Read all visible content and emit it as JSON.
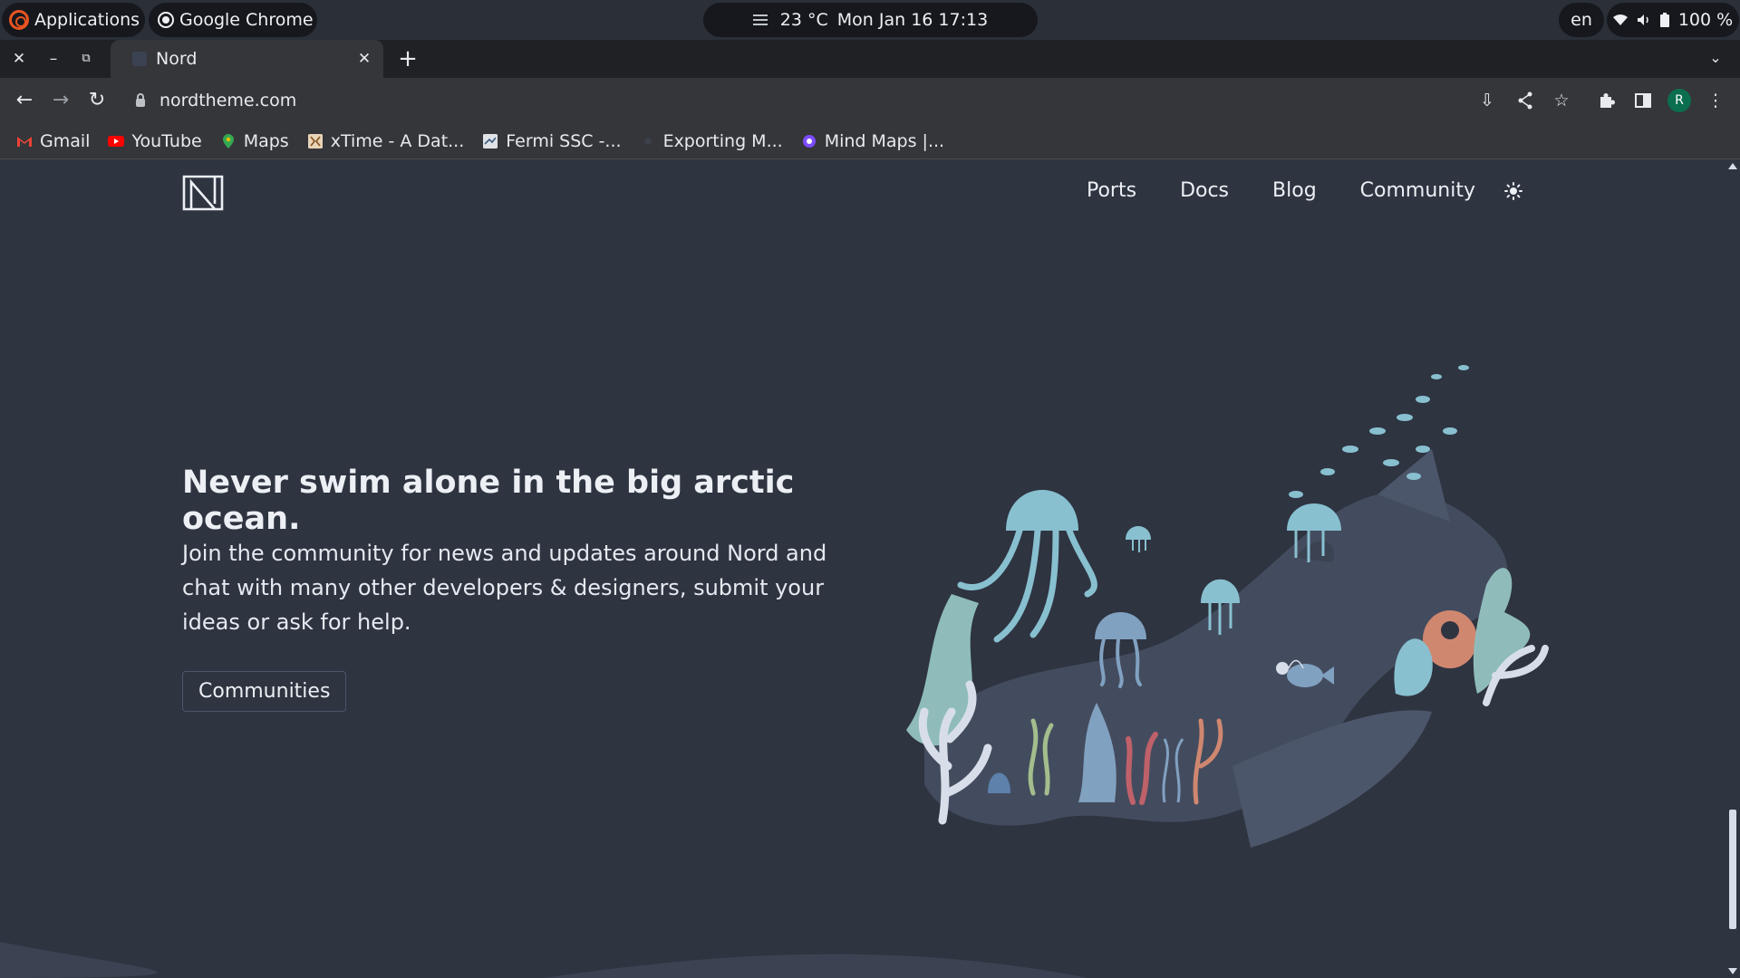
{
  "system_panel": {
    "apps_label": "Applications",
    "active_app": "Google Chrome",
    "weather": "23 °C",
    "datetime": "Mon Jan 16  17:13",
    "language": "en",
    "battery": "100 %"
  },
  "browser": {
    "tab_title": "Nord",
    "url": "nordtheme.com",
    "avatar_initial": "R",
    "bookmarks": [
      {
        "label": "Gmail",
        "icon": "gmail-icon",
        "color": "#ea4335"
      },
      {
        "label": "YouTube",
        "icon": "youtube-icon",
        "color": "#ff0000"
      },
      {
        "label": "Maps",
        "icon": "maps-icon",
        "color": "#34a853"
      },
      {
        "label": "xTime - A Dat...",
        "icon": "xtime-icon",
        "color": "#e8d4b8"
      },
      {
        "label": "Fermi SSC -...",
        "icon": "fermi-icon",
        "color": "#dfe3e8"
      },
      {
        "label": "Exporting M...",
        "icon": "exporting-icon",
        "color": "#3a3f4a"
      },
      {
        "label": "Mind Maps |...",
        "icon": "mindmaps-icon",
        "color": "#7c4dff"
      }
    ]
  },
  "site": {
    "nav": [
      "Ports",
      "Docs",
      "Blog",
      "Community"
    ],
    "theme_toggle_icon": "sun-icon",
    "hero_title": "Never swim alone in the big arctic ocean.",
    "hero_text": "Join the community for news and updates around Nord and chat with many other developers & designers, submit your ideas or ask for help.",
    "cta_label": "Communities"
  },
  "colors": {
    "page_bg": "#2e3440",
    "text": "#eceff4",
    "frost": "#88c0d0",
    "frost_light": "#8fbcbb",
    "frost_blue": "#81a1c1",
    "deep_blue": "#5e81ac",
    "aurora_red": "#bf616a",
    "aurora_orange": "#d08770",
    "aurora_green": "#a3be8c"
  }
}
